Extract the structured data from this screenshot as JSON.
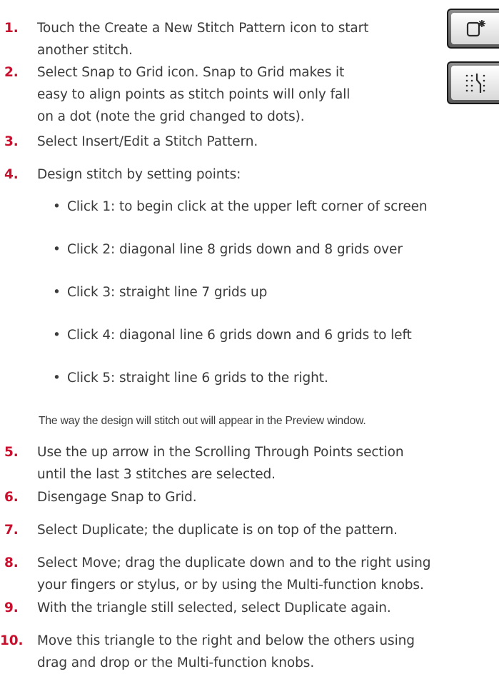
{
  "steps": [
    {
      "num": "1.",
      "lines": [
        "Touch the Create a New Stitch Pattern icon to start",
        "another stitch."
      ]
    },
    {
      "num": "2.",
      "lines": [
        "Select Snap to Grid icon. Snap to Grid makes it",
        "easy to align points as stitch points will only fall",
        "on a dot (note the grid changed to dots)."
      ]
    },
    {
      "num": "3.",
      "lines": [
        "Select Insert/Edit a Stitch Pattern."
      ]
    },
    {
      "num": "4.",
      "lines": [
        "Design stitch by setting points:"
      ]
    },
    {
      "num": "5.",
      "lines": [
        "Use the up arrow in the Scrolling Through Points section",
        "until the last 3 stitches are selected."
      ]
    },
    {
      "num": "6.",
      "lines": [
        "Disengage Snap to Grid."
      ]
    },
    {
      "num": "7.",
      "lines": [
        "Select Duplicate; the duplicate is on top of the pattern."
      ]
    },
    {
      "num": "8.",
      "lines": [
        "Select Move; drag the duplicate down and to the right using",
        "your fingers or stylus, or by using the Multi-function knobs."
      ]
    },
    {
      "num": "9.",
      "lines": [
        "With the triangle still selected, select Duplicate again."
      ]
    },
    {
      "num": "10.",
      "lines": [
        "Move this triangle to the right and below the others using",
        "drag and drop or the Multi-function knobs."
      ]
    }
  ],
  "bullets": [
    "Click 1: to begin click at the upper left corner of screen",
    "Click 2: diagonal line 8 grids down and 8 grids over",
    "Click 3: straight line 7 grids up",
    "Click 4: diagonal line 6 grids down and 6 grids to left",
    "Click 5: straight line 6 grids to the right."
  ],
  "bullet_glyph": "•",
  "note": "The way the design will stitch out will appear in the Preview window.",
  "icons": [
    "create-new-stitch-pattern-icon",
    "snap-to-grid-icon"
  ],
  "colors": {
    "step_number": "#c8102e",
    "text": "#3b3b3b"
  }
}
